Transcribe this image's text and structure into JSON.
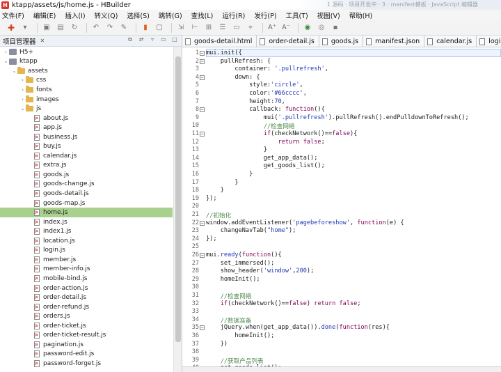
{
  "window": {
    "title": "ktapp/assets/js/home.js - HBuilder",
    "ghost_text": "1 源码 · 项目开发中 · 3 · manifest模板 · JavaScript 编辑器"
  },
  "menu": [
    "文件(F)",
    "编辑(E)",
    "插入(I)",
    "转义(Q)",
    "选择(S)",
    "跳转(G)",
    "查找(L)",
    "运行(R)",
    "发行(P)",
    "工具(T)",
    "视图(V)",
    "帮助(H)"
  ],
  "toolbar": {
    "icons": [
      "plus-icon",
      "dropdown-icon",
      "save-icon",
      "save-all-icon",
      "refresh-icon",
      "undo-icon",
      "redo-icon",
      "format-icon",
      "bookmark-icon",
      "file-icon",
      "export-icon",
      "bracket-icon",
      "insert-icon",
      "list-icon",
      "comment-icon",
      "pin-icon",
      "font-increase-icon",
      "font-decrease-icon",
      "run-icon",
      "browser-icon",
      "stop-icon"
    ]
  },
  "left_panel": {
    "title": "项目管理器",
    "close": "✕"
  },
  "tree": [
    {
      "label": "H5+",
      "level": 0,
      "kind": "project",
      "arrow": "›"
    },
    {
      "label": "ktapp",
      "level": 0,
      "kind": "project",
      "arrow": "⌄"
    },
    {
      "label": "assets",
      "level": 1,
      "kind": "folder",
      "arrow": "⌄"
    },
    {
      "label": "css",
      "level": 2,
      "kind": "folder",
      "arrow": "›"
    },
    {
      "label": "fonts",
      "level": 2,
      "kind": "folder",
      "arrow": "›"
    },
    {
      "label": "images",
      "level": 2,
      "kind": "folder",
      "arrow": "›"
    },
    {
      "label": "js",
      "level": 2,
      "kind": "folder",
      "arrow": "⌄"
    },
    {
      "label": "about.js",
      "level": 3,
      "kind": "file"
    },
    {
      "label": "app.js",
      "level": 3,
      "kind": "file"
    },
    {
      "label": "business.js",
      "level": 3,
      "kind": "file"
    },
    {
      "label": "buy.js",
      "level": 3,
      "kind": "file"
    },
    {
      "label": "calendar.js",
      "level": 3,
      "kind": "file"
    },
    {
      "label": "extra.js",
      "level": 3,
      "kind": "file"
    },
    {
      "label": "goods.js",
      "level": 3,
      "kind": "file"
    },
    {
      "label": "goods-change.js",
      "level": 3,
      "kind": "file"
    },
    {
      "label": "goods-detail.js",
      "level": 3,
      "kind": "file"
    },
    {
      "label": "goods-map.js",
      "level": 3,
      "kind": "file"
    },
    {
      "label": "home.js",
      "level": 3,
      "kind": "file",
      "selected": true
    },
    {
      "label": "index.js",
      "level": 3,
      "kind": "file"
    },
    {
      "label": "index1.js",
      "level": 3,
      "kind": "file"
    },
    {
      "label": "location.js",
      "level": 3,
      "kind": "file"
    },
    {
      "label": "login.js",
      "level": 3,
      "kind": "file"
    },
    {
      "label": "member.js",
      "level": 3,
      "kind": "file"
    },
    {
      "label": "member-info.js",
      "level": 3,
      "kind": "file"
    },
    {
      "label": "mobile-bind.js",
      "level": 3,
      "kind": "file"
    },
    {
      "label": "order-action.js",
      "level": 3,
      "kind": "file"
    },
    {
      "label": "order-detail.js",
      "level": 3,
      "kind": "file"
    },
    {
      "label": "order-refund.js",
      "level": 3,
      "kind": "file"
    },
    {
      "label": "orders.js",
      "level": 3,
      "kind": "file"
    },
    {
      "label": "order-ticket.js",
      "level": 3,
      "kind": "file"
    },
    {
      "label": "order-ticket-result.js",
      "level": 3,
      "kind": "file"
    },
    {
      "label": "pagination.js",
      "level": 3,
      "kind": "file"
    },
    {
      "label": "password-edit.js",
      "level": 3,
      "kind": "file"
    },
    {
      "label": "password-forget.js",
      "level": 3,
      "kind": "file"
    }
  ],
  "tabs": [
    "goods-detail.html",
    "order-detail.js",
    "goods.js",
    "manifest.json",
    "calendar.js",
    "login"
  ],
  "code": [
    [
      [
        "p",
        "mui.init({"
      ]
    ],
    [
      [
        "p",
        "    pullRefresh: {"
      ]
    ],
    [
      [
        "p",
        "        container: "
      ],
      [
        "s",
        "'.pullrefresh'"
      ],
      [
        "p",
        ","
      ]
    ],
    [
      [
        "p",
        "        down: {"
      ]
    ],
    [
      [
        "p",
        "            style:"
      ],
      [
        "s",
        "'circle'"
      ],
      [
        "p",
        ","
      ]
    ],
    [
      [
        "p",
        "            color:"
      ],
      [
        "s",
        "'#66cccc'"
      ],
      [
        "p",
        ","
      ]
    ],
    [
      [
        "p",
        "            height:"
      ],
      [
        "n",
        "70"
      ],
      [
        "p",
        ","
      ]
    ],
    [
      [
        "p",
        "            callback: "
      ],
      [
        "k",
        "function"
      ],
      [
        "p",
        "(){"
      ]
    ],
    [
      [
        "p",
        "                mui("
      ],
      [
        "s",
        "'.pullrefresh'"
      ],
      [
        "p",
        ").pullRefresh().endPulldownToRefresh();"
      ]
    ],
    [
      [
        "c",
        "                //检查网络"
      ]
    ],
    [
      [
        "p",
        "                "
      ],
      [
        "k",
        "if"
      ],
      [
        "p",
        "(checkNetwork()=="
      ],
      [
        "k",
        "false"
      ],
      [
        "p",
        "){"
      ]
    ],
    [
      [
        "p",
        "                    "
      ],
      [
        "k",
        "return false"
      ],
      [
        "p",
        ";"
      ]
    ],
    [
      [
        "p",
        "                }"
      ]
    ],
    [
      [
        "p",
        "                get_app_data();"
      ]
    ],
    [
      [
        "p",
        "                get_goods_list();"
      ]
    ],
    [
      [
        "p",
        "            }"
      ]
    ],
    [
      [
        "p",
        "        }"
      ]
    ],
    [
      [
        "p",
        "    }"
      ]
    ],
    [
      [
        "p",
        "});"
      ]
    ],
    [
      [
        "p",
        ""
      ]
    ],
    [
      [
        "c",
        "//初始化"
      ]
    ],
    [
      [
        "p",
        "window.addEventListener("
      ],
      [
        "s",
        "'pagebeforeshow'"
      ],
      [
        "p",
        ", "
      ],
      [
        "k",
        "function"
      ],
      [
        "p",
        "(e) {"
      ]
    ],
    [
      [
        "p",
        "    changeNavTab("
      ],
      [
        "s",
        "\"home\""
      ],
      [
        "p",
        ");"
      ]
    ],
    [
      [
        "p",
        "});"
      ]
    ],
    [
      [
        "p",
        ""
      ]
    ],
    [
      [
        "p",
        "mui."
      ],
      [
        "f",
        "ready"
      ],
      [
        "p",
        "("
      ],
      [
        "k",
        "function"
      ],
      [
        "p",
        "(){"
      ]
    ],
    [
      [
        "p",
        "    set_immersed();"
      ]
    ],
    [
      [
        "p",
        "    show_header("
      ],
      [
        "s",
        "'window'"
      ],
      [
        "p",
        ","
      ],
      [
        "n",
        "200"
      ],
      [
        "p",
        ");"
      ]
    ],
    [
      [
        "p",
        "    homeInit();"
      ]
    ],
    [
      [
        "p",
        ""
      ]
    ],
    [
      [
        "c",
        "    //检查网络"
      ]
    ],
    [
      [
        "p",
        "    "
      ],
      [
        "k",
        "if"
      ],
      [
        "p",
        "(checkNetwork()=="
      ],
      [
        "k",
        "false"
      ],
      [
        "p",
        ") "
      ],
      [
        "k",
        "return false"
      ],
      [
        "p",
        ";"
      ]
    ],
    [
      [
        "p",
        ""
      ]
    ],
    [
      [
        "c",
        "    //数据准备"
      ]
    ],
    [
      [
        "p",
        "    jQuery.when(get_app_data())."
      ],
      [
        "f",
        "done"
      ],
      [
        "p",
        "("
      ],
      [
        "k",
        "function"
      ],
      [
        "p",
        "(res){"
      ]
    ],
    [
      [
        "p",
        "        homeInit();"
      ]
    ],
    [
      [
        "p",
        "    })"
      ]
    ],
    [
      [
        "p",
        ""
      ]
    ],
    [
      [
        "c",
        "    //获取产品列表"
      ]
    ],
    [
      [
        "p",
        "    get_goods_list();"
      ]
    ]
  ],
  "fold_lines": [
    1,
    2,
    4,
    8,
    11,
    22,
    26,
    35
  ]
}
